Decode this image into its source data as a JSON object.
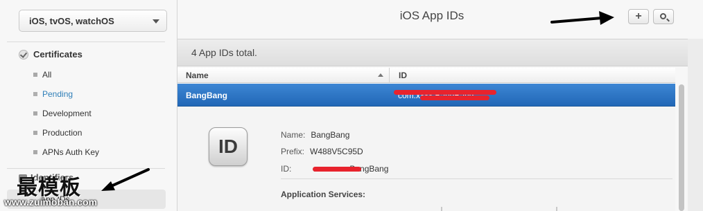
{
  "sidebar": {
    "platform": "iOS, tvOS, watchOS",
    "section": "Certificates",
    "items": [
      {
        "label": "All"
      },
      {
        "label": "Pending"
      },
      {
        "label": "Development"
      },
      {
        "label": "Production"
      },
      {
        "label": "APNs Auth Key"
      }
    ],
    "next_section": "Identifiers",
    "current_item": "App IDs"
  },
  "watermark": {
    "text": "最模板",
    "url": "www.zuimoban.com"
  },
  "header": {
    "title": "iOS App IDs",
    "add_button": "+"
  },
  "summary": "4  App IDs total.",
  "table": {
    "columns": [
      "Name",
      "ID"
    ],
    "selected_row": {
      "name": "BangBang",
      "id": "com.xxxx.BangBang"
    }
  },
  "detail": {
    "badge": "ID",
    "fields": [
      {
        "label": "Name:",
        "value": "BangBang"
      },
      {
        "label": "Prefix:",
        "value": "W488V5C95D"
      },
      {
        "label": "ID:",
        "value": "com.xxxx.BangBang"
      }
    ],
    "services_label": "Application Services:"
  },
  "colors": {
    "accent": "#2f7fb8",
    "selection": "#2167b6",
    "redaction": "#e8232d"
  }
}
